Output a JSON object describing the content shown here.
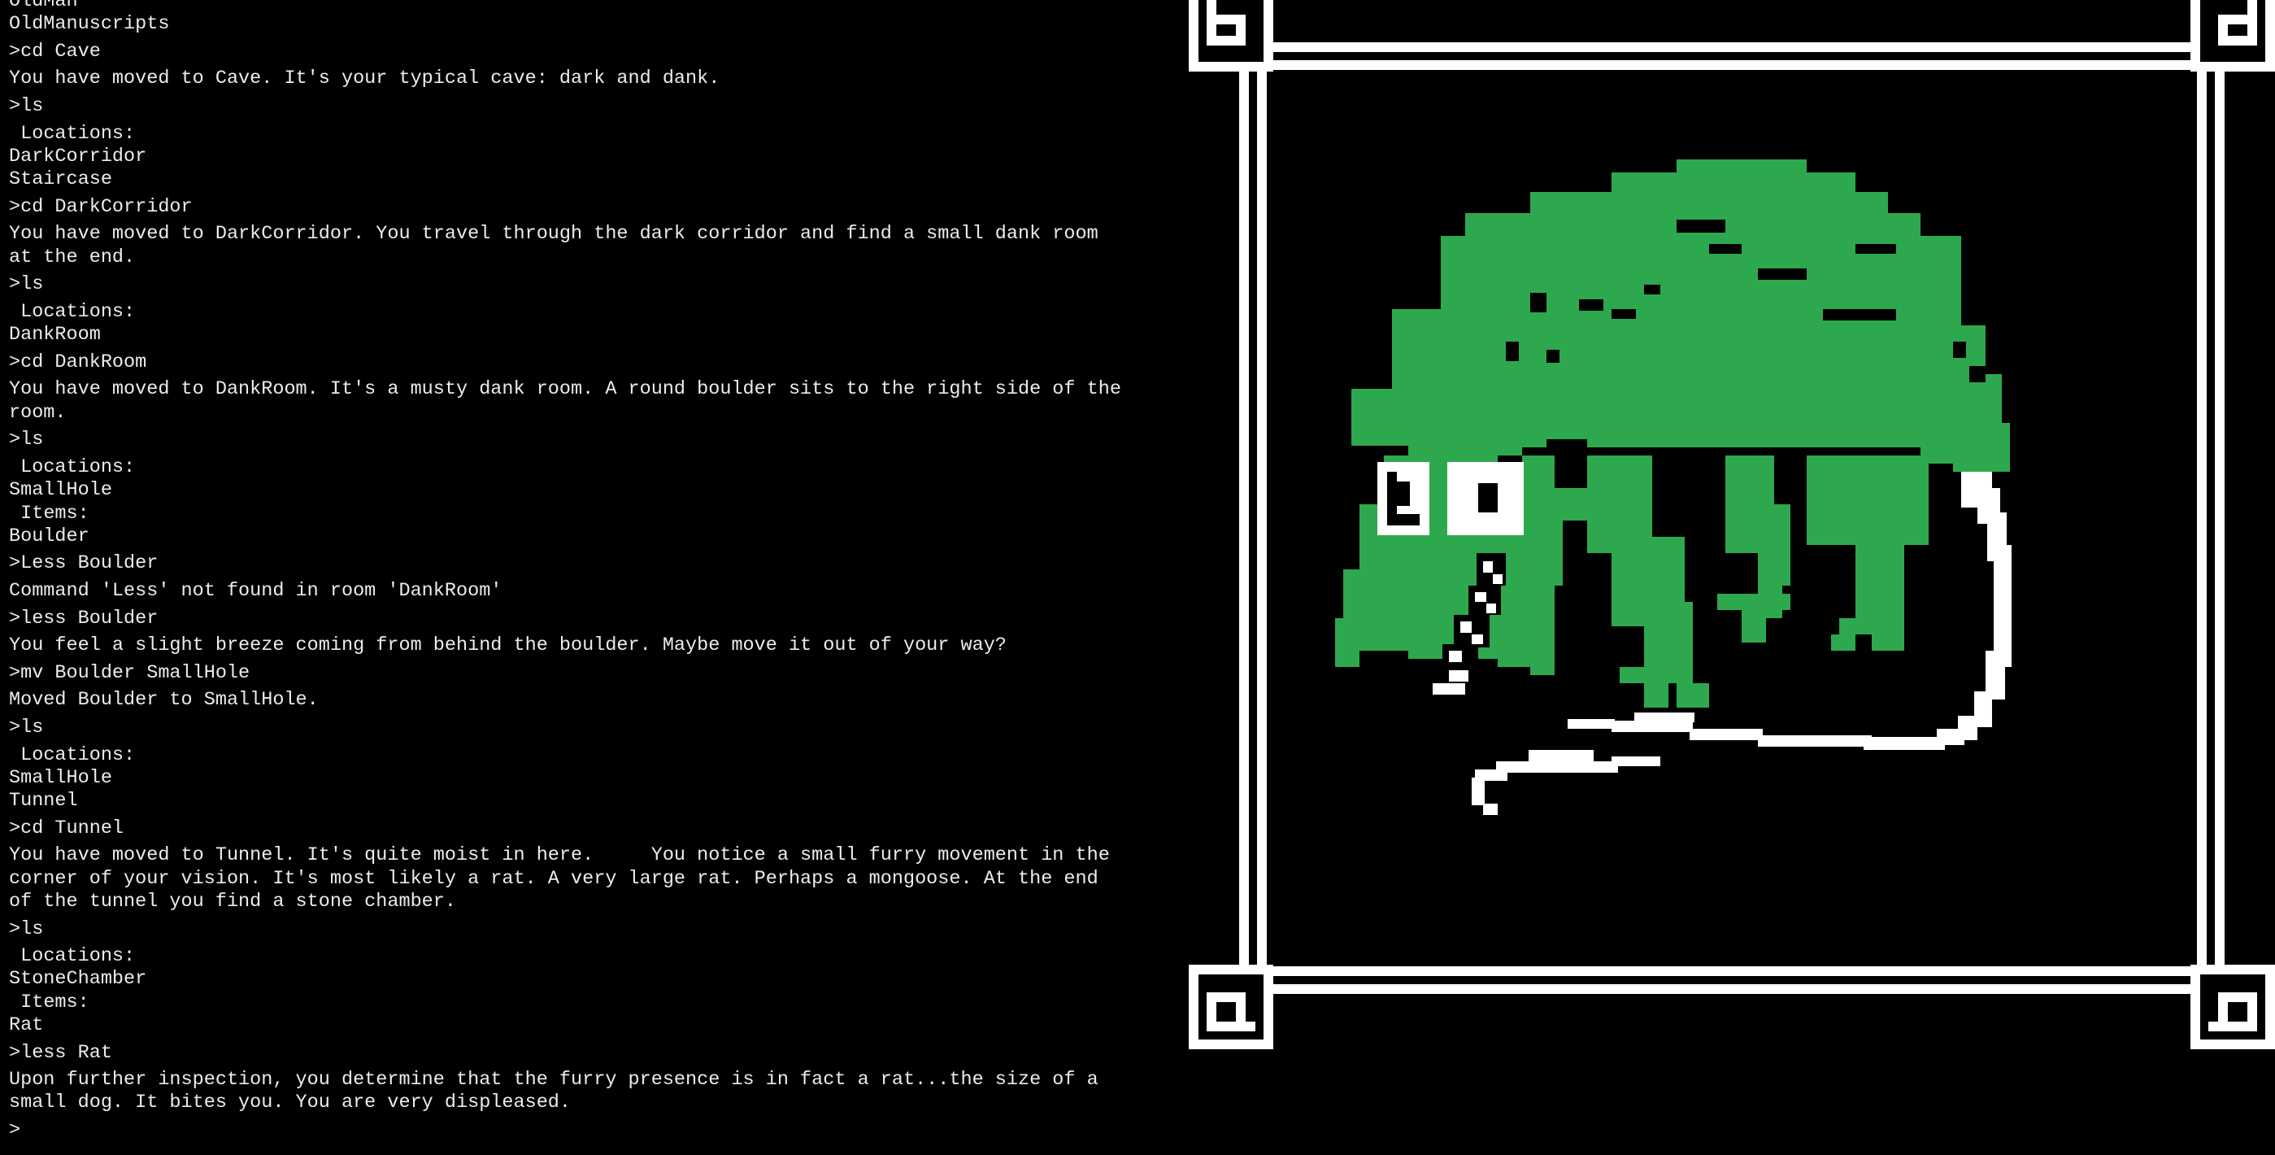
{
  "terminal": {
    "lines": [
      {
        "kind": "out",
        "text": "OldMan"
      },
      {
        "kind": "out",
        "text": "OldManuscripts"
      },
      {
        "kind": "cmd",
        "text": ">cd Cave"
      },
      {
        "kind": "out",
        "text": "You have moved to Cave. It's your typical cave: dark and dank."
      },
      {
        "kind": "cmd",
        "text": ">ls"
      },
      {
        "kind": "out",
        "text": " Locations:"
      },
      {
        "kind": "out",
        "text": "DarkCorridor"
      },
      {
        "kind": "out",
        "text": "Staircase"
      },
      {
        "kind": "cmd",
        "text": ">cd DarkCorridor"
      },
      {
        "kind": "out",
        "text": "You have moved to DarkCorridor. You travel through the dark corridor and find a small dank room\nat the end."
      },
      {
        "kind": "cmd",
        "text": ">ls"
      },
      {
        "kind": "out",
        "text": " Locations:"
      },
      {
        "kind": "out",
        "text": "DankRoom"
      },
      {
        "kind": "cmd",
        "text": ">cd DankRoom"
      },
      {
        "kind": "out",
        "text": "You have moved to DankRoom. It's a musty dank room. A round boulder sits to the right side of the\nroom."
      },
      {
        "kind": "cmd",
        "text": ">ls"
      },
      {
        "kind": "out",
        "text": " Locations:"
      },
      {
        "kind": "out",
        "text": "SmallHole"
      },
      {
        "kind": "out",
        "text": " Items:"
      },
      {
        "kind": "out",
        "text": "Boulder"
      },
      {
        "kind": "cmd",
        "text": ">Less Boulder"
      },
      {
        "kind": "out",
        "text": "Command 'Less' not found in room 'DankRoom'"
      },
      {
        "kind": "cmd",
        "text": ">less Boulder"
      },
      {
        "kind": "out",
        "text": "You feel a slight breeze coming from behind the boulder. Maybe move it out of your way?"
      },
      {
        "kind": "cmd",
        "text": ">mv Boulder SmallHole"
      },
      {
        "kind": "out",
        "text": "Moved Boulder to SmallHole."
      },
      {
        "kind": "cmd",
        "text": ">ls"
      },
      {
        "kind": "out",
        "text": " Locations:"
      },
      {
        "kind": "out",
        "text": "SmallHole"
      },
      {
        "kind": "out",
        "text": "Tunnel"
      },
      {
        "kind": "cmd",
        "text": ">cd Tunnel"
      },
      {
        "kind": "out",
        "text": "You have moved to Tunnel. It's quite moist in here.     You notice a small furry movement in the\ncorner of your vision. It's most likely a rat. A very large rat. Perhaps a mongoose. At the end\nof the tunnel you find a stone chamber."
      },
      {
        "kind": "cmd",
        "text": ">ls"
      },
      {
        "kind": "out",
        "text": " Locations:"
      },
      {
        "kind": "out",
        "text": "StoneChamber"
      },
      {
        "kind": "out",
        "text": " Items:"
      },
      {
        "kind": "out",
        "text": "Rat"
      },
      {
        "kind": "cmd",
        "text": ">less Rat"
      },
      {
        "kind": "out",
        "text": "Upon further inspection, you determine that the furry presence is in fact a rat...the size of a\nsmall dog. It bites you. You are very displeased."
      }
    ],
    "prompt": ">"
  },
  "art": {
    "subject": "rat-sprite",
    "frame_color": "#ffffff",
    "body_color": "#2ea84e",
    "tail_color": "#ffffff",
    "eye_color": "#ffffff",
    "pupil_color": "#000000",
    "background_color": "#000000"
  }
}
